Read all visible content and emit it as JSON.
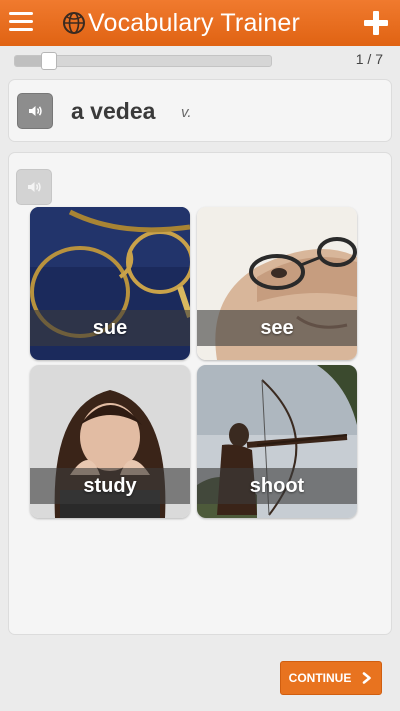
{
  "header": {
    "title": "Vocabulary Trainer",
    "menu_icon": "hamburger-menu-icon",
    "logo_icon": "globe-icon",
    "add_icon": "plus-icon",
    "background": "#e8711f"
  },
  "progress": {
    "current": 1,
    "total": 7,
    "label": "1 / 7",
    "fraction": 0.14
  },
  "word": {
    "text": "a vedea",
    "part_of_speech": "v.",
    "audio_icon": "speaker-icon"
  },
  "quiz": {
    "audio_icon": "speaker-icon",
    "choices": [
      {
        "label": "sue"
      },
      {
        "label": "see"
      },
      {
        "label": "study"
      },
      {
        "label": "shoot"
      }
    ]
  },
  "footer": {
    "continue_label": "CONTINUE",
    "continue_icon": "chevron-right-icon",
    "accent": "#e8731f"
  }
}
